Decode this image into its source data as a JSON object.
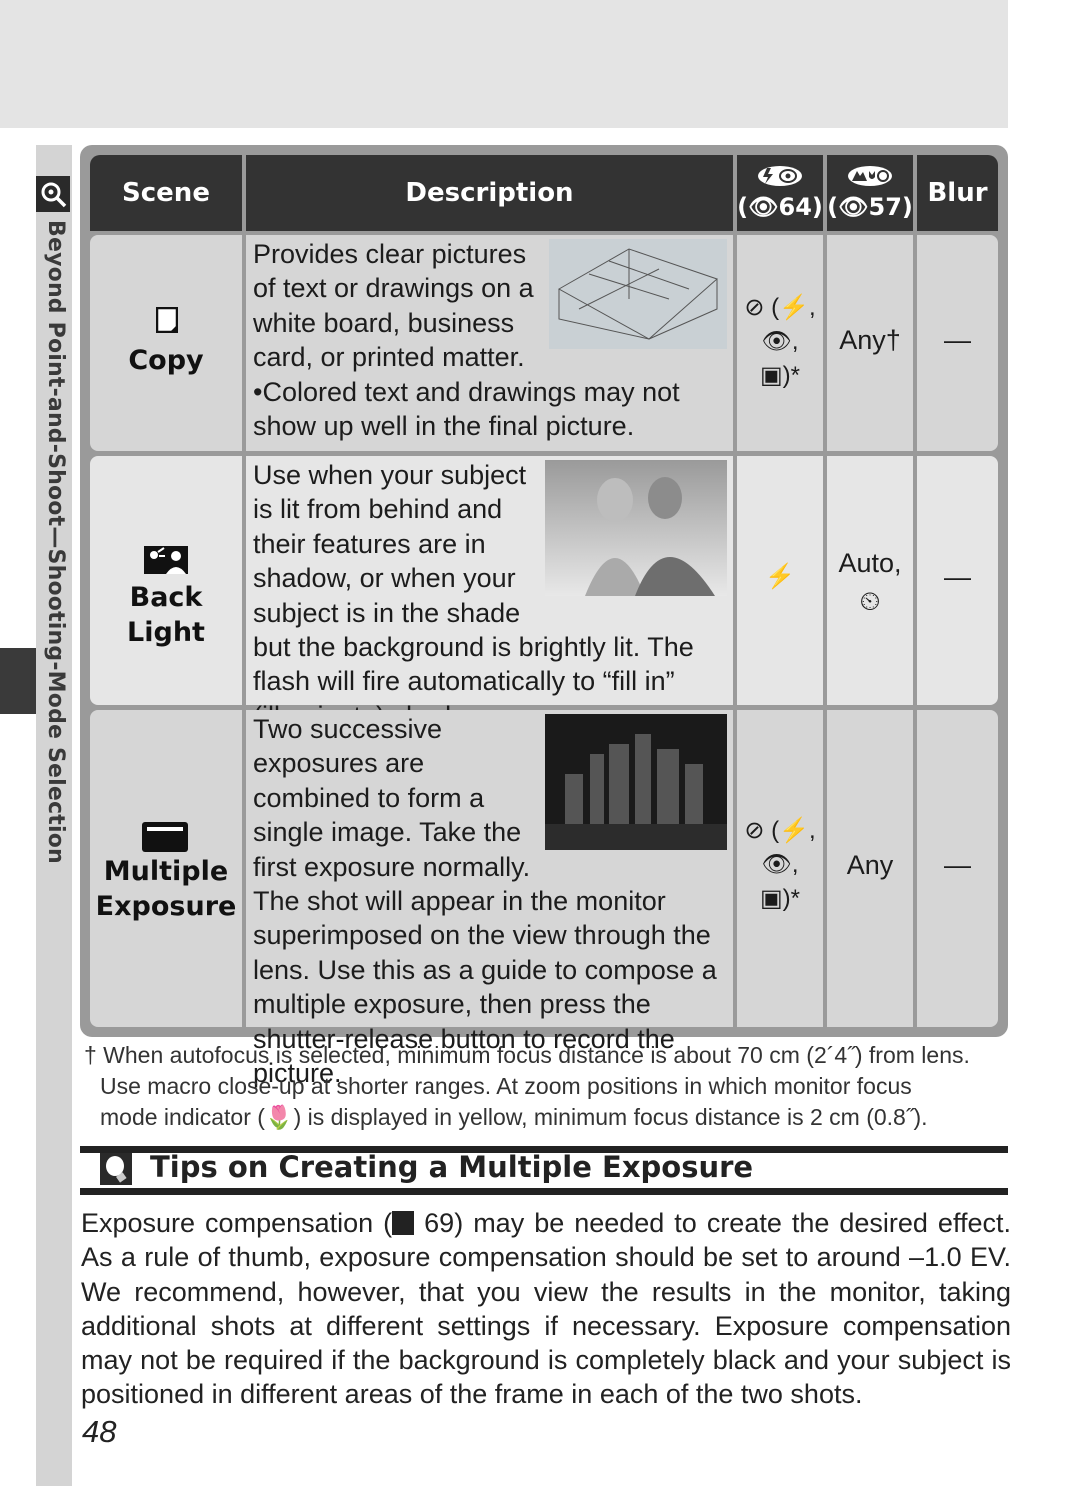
{
  "side": {
    "section_title": "Beyond Point-and-Shoot—Shooting-Mode Selection"
  },
  "table": {
    "headers": {
      "scene": "Scene",
      "description": "Description",
      "flash_ref": "(👁64)",
      "focus_ref": "(👁57)",
      "blur": "Blur"
    },
    "rows": [
      {
        "scene": "Copy",
        "scene_icon": "copy-scene-icon",
        "desc_wrapped": "Provides clear pictures of text or drawings on a white board, business card, or printed matter.",
        "desc_bullet": "•Colored text and drawings may not show up well in the final picture.",
        "photo": "building-diagram-image",
        "flash": [
          "⊘ (⚡,",
          "👁,",
          "▣)*"
        ],
        "focus": "Any†",
        "blur": "—"
      },
      {
        "scene": "Back Light",
        "scene_icon": "back-light-scene-icon",
        "desc_wrapped": "Use when your subject is lit from behind and their features are in shadow, or when your subject is in the shade but the background is brightly lit.  The flash will fire automatically to “fill in” (illuminate) shadows.",
        "photo": "couple-portrait-image",
        "flash": [
          "⚡"
        ],
        "focus": [
          "Auto,",
          "⏲"
        ],
        "blur": "—"
      },
      {
        "scene": "Multiple Exposure",
        "scene_icon": "multiple-exposure-scene-icon",
        "desc_wrapped": "Two successive exposures are combined to form a single image.  Take the first exposure normally. The shot will appear in the monitor superimposed on the view through the lens.  Use this as a guide to compose a multiple exposure, then press the shutter-release button to record the picture.",
        "photo": "night-city-image",
        "flash": [
          "⊘ (⚡,",
          "👁,",
          "▣)*"
        ],
        "focus": "Any",
        "blur": "—"
      }
    ]
  },
  "footnote": {
    "line1": "† When autofocus is selected, minimum focus distance is about 70 cm (2´4˝) from lens.",
    "line2": "Use macro close-up at shorter ranges.  At zoom positions in which monitor focus",
    "line3_before": "mode indicator (",
    "line3_after": ") is displayed in yellow, minimum focus distance is 2 cm (0.8˝)."
  },
  "tips": {
    "title": "Tips on Creating a Multiple Exposure",
    "body_before": "Exposure compensation (",
    "body_ref": "69",
    "body_after": ") may be needed to create the desired effect. As a rule of thumb, exposure compensation should be set to around –1.0 EV. We recommend, however, that you view the results in the monitor, taking additional shots at different settings if necessary.  Exposure compensation may not be required if the background is completely black and your subject is positioned in different areas of the frame in each of the two shots."
  },
  "page_number": "48"
}
